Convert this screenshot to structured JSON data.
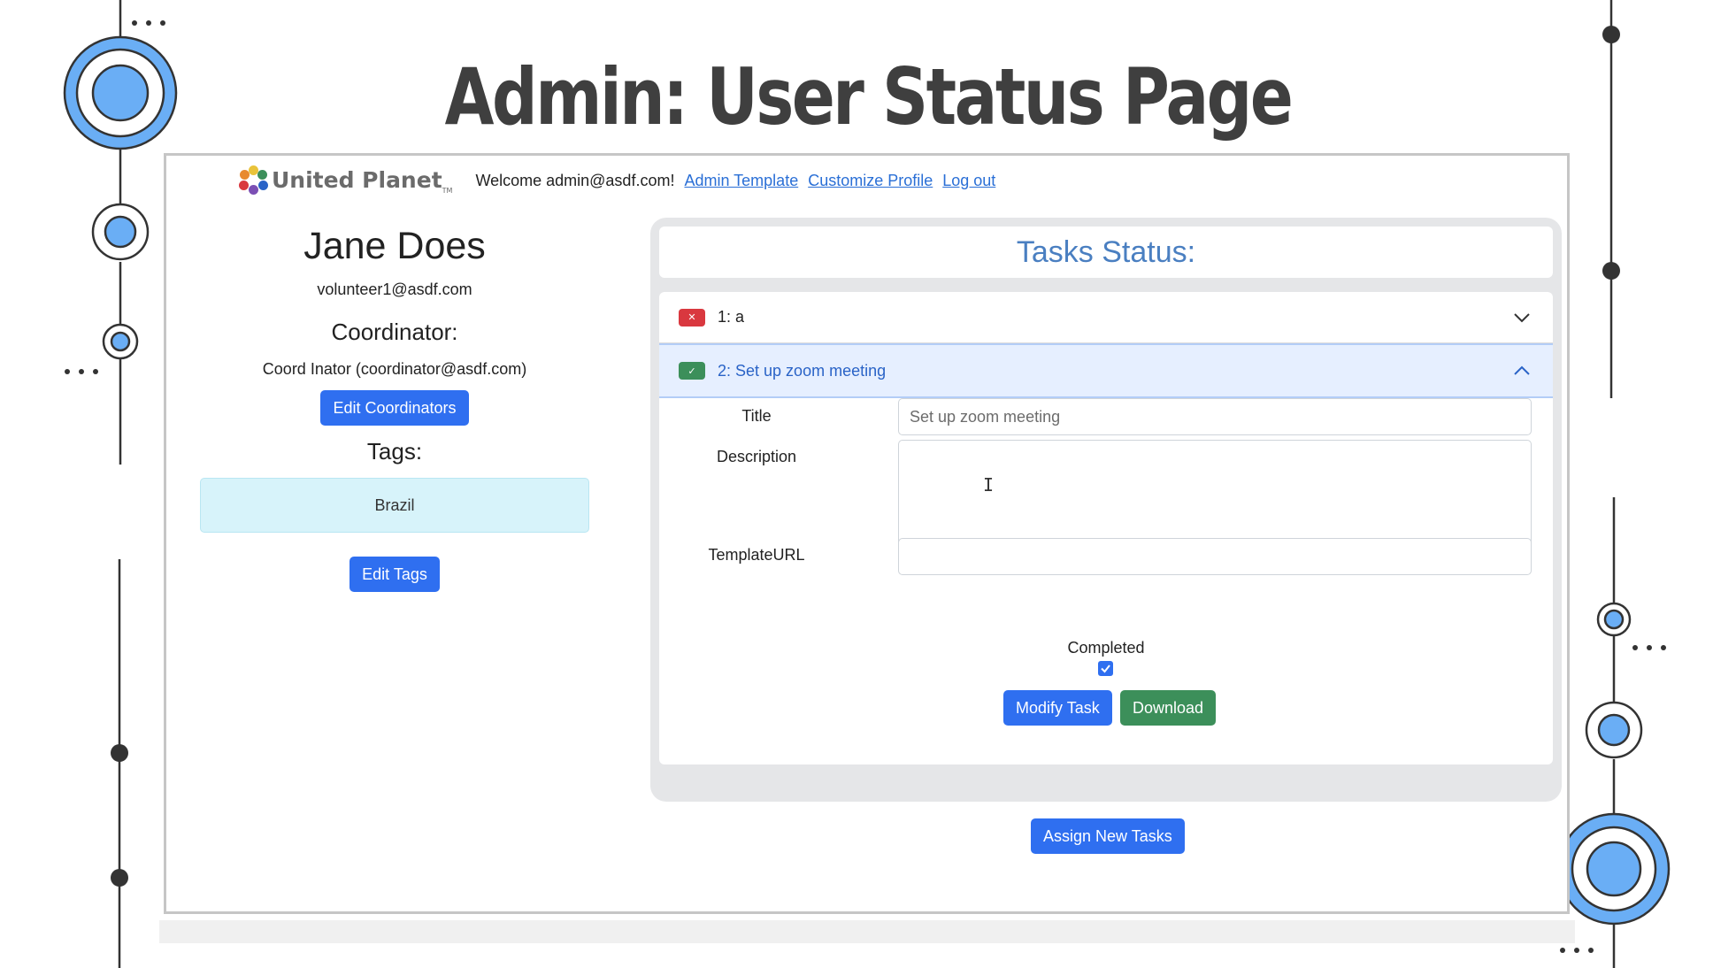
{
  "slide": {
    "title": "Admin: User Status Page"
  },
  "nav": {
    "logo_text": "United Planet",
    "logo_tm": "TM",
    "welcome": "Welcome admin@asdf.com!",
    "links": [
      "Admin Template",
      "Customize Profile",
      "Log out"
    ]
  },
  "user": {
    "name": "Jane Does",
    "email": "volunteer1@asdf.com",
    "coordinator_heading": "Coordinator:",
    "coordinator": "Coord Inator (coordinator@asdf.com)",
    "edit_coordinators_label": "Edit Coordinators",
    "tags_heading": "Tags:",
    "tags": [
      "Brazil"
    ],
    "edit_tags_label": "Edit Tags"
  },
  "tasks": {
    "heading": "Tasks Status:",
    "items": [
      {
        "label": "1: a",
        "status": "incomplete",
        "icon": "x-icon",
        "expanded": false
      },
      {
        "label": "2: Set up zoom meeting",
        "status": "complete",
        "icon": "check-icon",
        "expanded": true
      }
    ],
    "form": {
      "title_label": "Title",
      "title_placeholder": "Set up zoom meeting",
      "description_label": "Description",
      "template_url_label": "TemplateURL",
      "completed_label": "Completed",
      "completed": true,
      "modify_label": "Modify Task",
      "download_label": "Download"
    },
    "assign_label": "Assign New Tasks"
  },
  "colors": {
    "primary": "#2f6ff0",
    "success": "#3c8f5a",
    "danger": "#d9383f",
    "heading_blue": "#4a7fc1",
    "tag_bg": "#d7f3fa",
    "deco_blue": "#6aaef5"
  }
}
